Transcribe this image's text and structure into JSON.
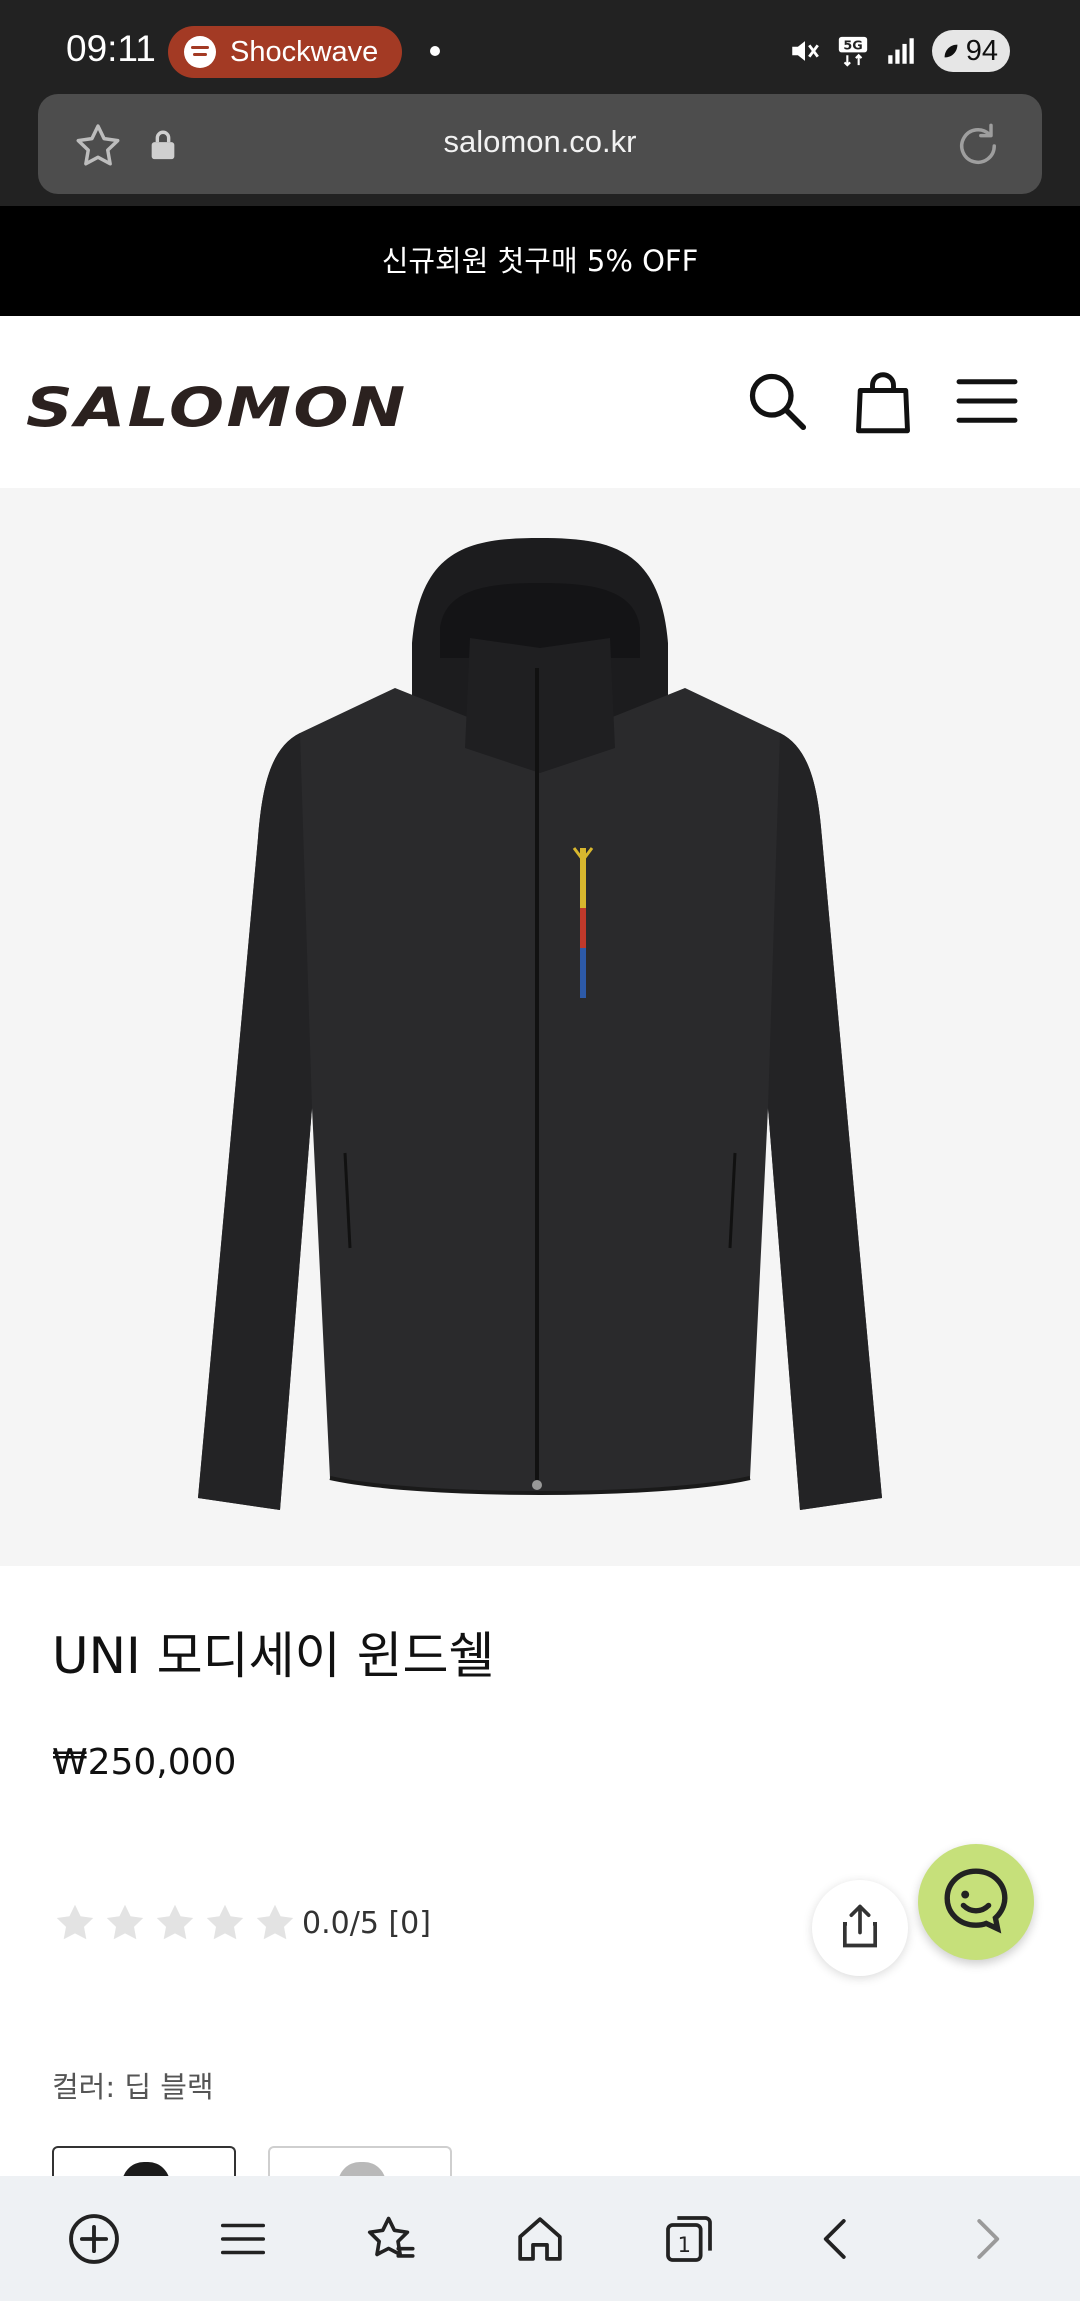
{
  "status_bar": {
    "time": "09:11",
    "media_app": "Shockwave",
    "battery": "94",
    "icons": [
      "spotify-icon",
      "mute-icon",
      "5g-icon",
      "signal-icon",
      "battery-icon"
    ]
  },
  "browser": {
    "url": "salomon.co.kr",
    "icons": [
      "star-icon",
      "lock-icon",
      "reload-icon"
    ]
  },
  "promo_banner": {
    "text": "신규회원 첫구매 5% OFF"
  },
  "site_header": {
    "logo": "SALOMON",
    "icons": [
      "search-icon",
      "shopping-bag-icon",
      "menu-icon"
    ]
  },
  "product": {
    "image": "black-jacket-image",
    "title": "UNI 모디세이 윈드쉘",
    "price": "₩250,000",
    "rating": {
      "value": 0.0,
      "max": 5,
      "text": "0.0/5 [0]",
      "review_count": 0
    },
    "color_label": "컬러: 딥 블랙",
    "swatches": [
      "black",
      "grey"
    ]
  },
  "floating": {
    "share_icon": "share-icon",
    "chat_icon": "chat-icon"
  },
  "bottom_nav": {
    "items": [
      "add-icon",
      "menu-icon",
      "bookmarks-icon",
      "home-icon",
      "tabs-icon",
      "back-icon",
      "forward-icon"
    ],
    "tabs_count": "1"
  },
  "colors": {
    "status_bar_bg": "#222222",
    "pill_bg": "#a33a24",
    "promo_bg": "#000000",
    "logo_color": "#2b211f",
    "chat_bg": "#c6e07a",
    "hero_bg": "#f5f5f5",
    "nav_bg": "#eef1f4"
  }
}
